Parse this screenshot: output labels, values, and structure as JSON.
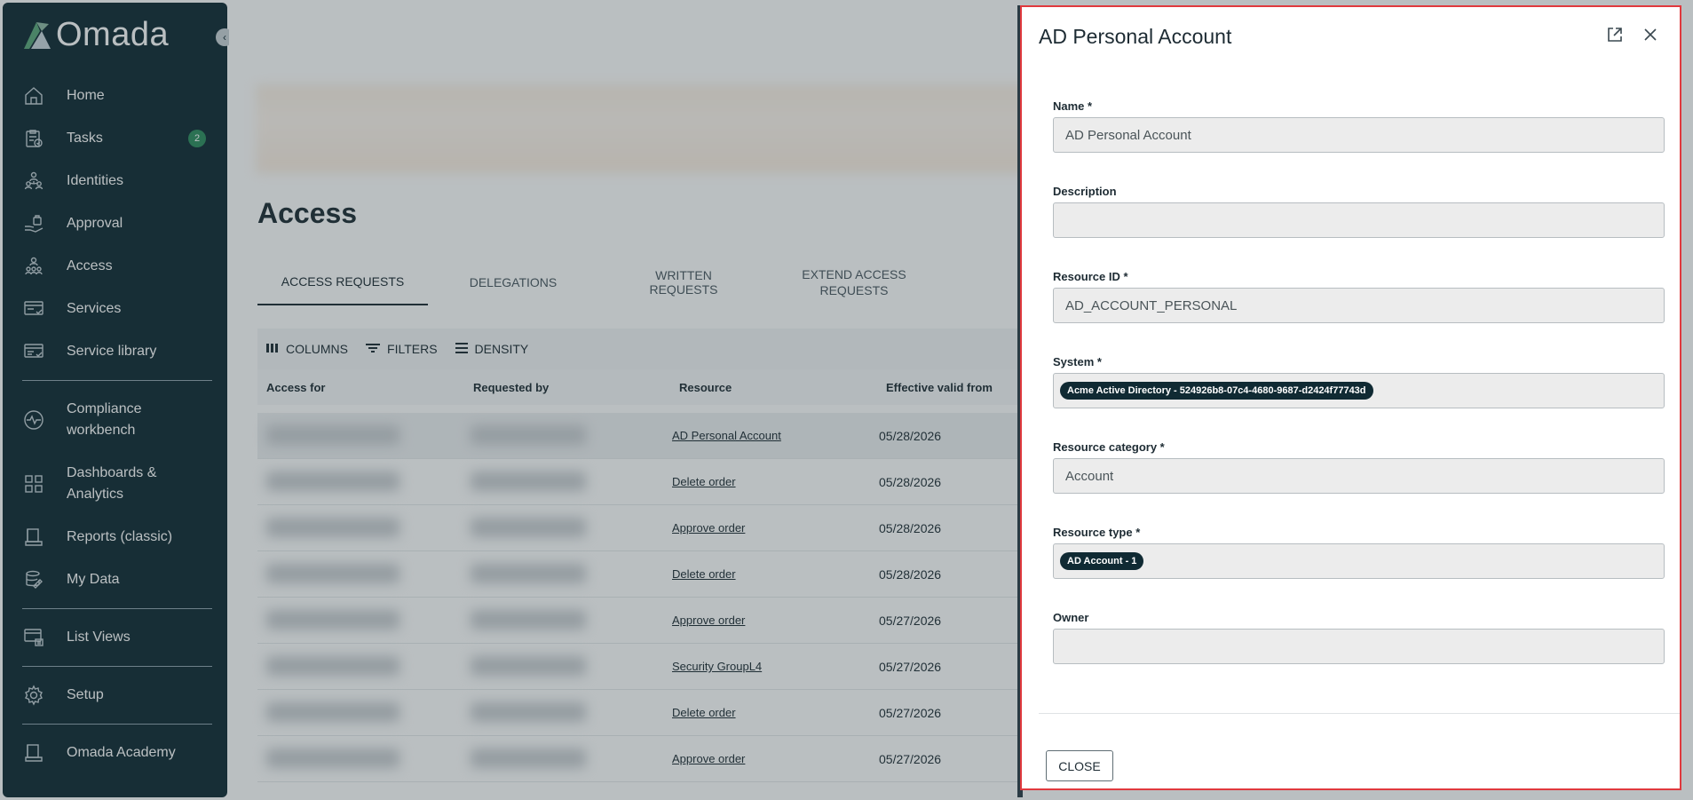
{
  "app": {
    "brand": "Omada"
  },
  "sidebar": {
    "items": [
      {
        "label": "Home",
        "icon": "home-icon"
      },
      {
        "label": "Tasks",
        "icon": "tasks-icon",
        "badge": "2"
      },
      {
        "label": "Identities",
        "icon": "identities-icon"
      },
      {
        "label": "Approval",
        "icon": "approval-icon"
      },
      {
        "label": "Access",
        "icon": "access-icon"
      },
      {
        "label": "Services",
        "icon": "services-icon"
      },
      {
        "label": "Service library",
        "icon": "service-library-icon"
      }
    ],
    "items2": [
      {
        "label": "Compliance\nworkbench",
        "icon": "compliance-icon"
      },
      {
        "label": "Dashboards &\nAnalytics",
        "icon": "dashboards-icon"
      },
      {
        "label": "Reports (classic)",
        "icon": "reports-icon"
      },
      {
        "label": "My Data",
        "icon": "my-data-icon"
      }
    ],
    "list_views": "List Views",
    "setup": "Setup",
    "academy": "Omada Academy"
  },
  "main": {
    "title": "Access",
    "tabs": [
      "ACCESS REQUESTS",
      "DELEGATIONS",
      "WRITTEN REQUESTS",
      "EXTEND ACCESS\nREQUESTS"
    ],
    "toolbar": {
      "columns": "COLUMNS",
      "filters": "FILTERS",
      "density": "DENSITY"
    },
    "columns": [
      "Access for",
      "Requested by",
      "Resource",
      "Effective valid from"
    ],
    "rows": [
      {
        "resource": "AD Personal Account",
        "date": "05/28/2026"
      },
      {
        "resource": "Delete order",
        "date": "05/28/2026"
      },
      {
        "resource": "Approve order",
        "date": "05/28/2026"
      },
      {
        "resource": "Delete order",
        "date": "05/28/2026"
      },
      {
        "resource": "Approve order",
        "date": "05/27/2026"
      },
      {
        "resource": "Security GroupL4",
        "date": "05/27/2026"
      },
      {
        "resource": "Delete order",
        "date": "05/27/2026"
      },
      {
        "resource": "Approve order",
        "date": "05/27/2026"
      }
    ]
  },
  "dialog": {
    "title": "AD Personal Account",
    "fields": {
      "name": {
        "label": "Name *",
        "value": "AD Personal Account"
      },
      "description": {
        "label": "Description",
        "value": ""
      },
      "resource_id": {
        "label": "Resource ID *",
        "value": "AD_ACCOUNT_PERSONAL"
      },
      "system": {
        "label": "System *",
        "chip": "Acme Active Directory - 524926b8-07c4-4680-9687-d2424f77743d"
      },
      "resource_category": {
        "label": "Resource category *",
        "value": "Account"
      },
      "resource_type": {
        "label": "Resource type *",
        "chip": "AD Account - 1"
      },
      "owner": {
        "label": "Owner",
        "value": ""
      }
    },
    "close_label": "CLOSE"
  },
  "colors": {
    "sidebar_bg": "#102a33",
    "badge": "#2d8c5e",
    "highlight_border": "#e0393e"
  }
}
